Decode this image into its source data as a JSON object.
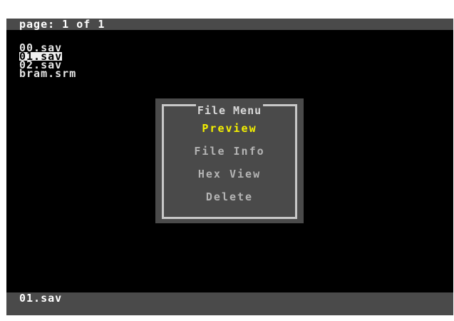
{
  "header": {
    "page_indicator": "page: 1 of 1"
  },
  "files": [
    {
      "name": "00.sav",
      "selected": false
    },
    {
      "name": "01.sav",
      "selected": true
    },
    {
      "name": "02.sav",
      "selected": false
    },
    {
      "name": "bram.srm",
      "selected": false
    }
  ],
  "file_menu": {
    "title": "File Menu",
    "items": [
      {
        "label": "Preview",
        "active": true
      },
      {
        "label": "File Info",
        "active": false
      },
      {
        "label": "Hex View",
        "active": false
      },
      {
        "label": "Delete",
        "active": false
      }
    ]
  },
  "status": {
    "selected_file": "01.sav"
  },
  "colors": {
    "bar_gray": "#4a4a4a",
    "screen_bg": "#000000",
    "highlight_yellow": "#f4f000",
    "menu_text": "#b4b4b4"
  }
}
